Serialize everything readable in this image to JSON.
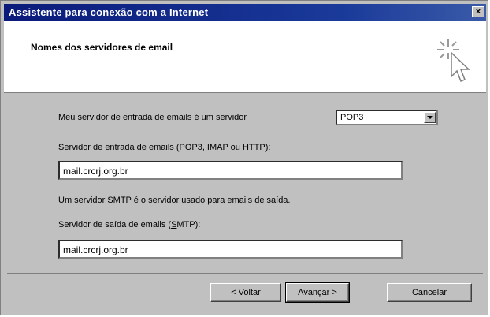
{
  "window": {
    "title": "Assistente para conexão com a Internet",
    "close_label": "×"
  },
  "header": {
    "title": "Nomes dos servidores de email",
    "icon": "magic-wand-cursor-icon"
  },
  "form": {
    "server_type_label_pre": "M",
    "server_type_label_u": "e",
    "server_type_label_post": "u servidor de entrada de emails é um  servidor",
    "server_type_value": "POP3",
    "incoming_label_pre": "Servi",
    "incoming_label_u": "d",
    "incoming_label_post": "or de entrada de emails (POP3, IMAP ou HTTP):",
    "incoming_value": "mail.crcrj.org.br",
    "smtp_info": "Um servidor SMTP é o servidor usado para emails de saída.",
    "outgoing_label_pre": "Servidor de saída de emails (",
    "outgoing_label_u": "S",
    "outgoing_label_post": "MTP):",
    "outgoing_value": "mail.crcrj.org.br"
  },
  "buttons": {
    "back_pre": "< ",
    "back_u": "V",
    "back_post": "oltar",
    "next_u": "A",
    "next_post": "vançar >",
    "cancel": "Cancelar"
  }
}
